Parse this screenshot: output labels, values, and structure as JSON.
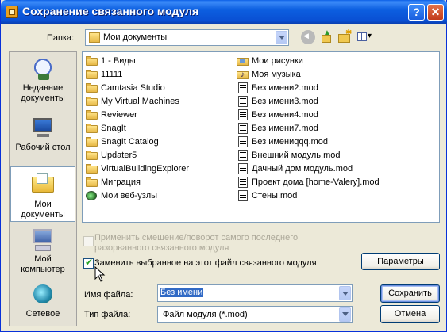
{
  "window": {
    "title": "Сохранение связанного модуля",
    "help_label": "?",
    "close_label": "✕"
  },
  "folder": {
    "label": "Папка:",
    "current": "Мои документы"
  },
  "places": [
    {
      "label": "Недавние документы",
      "icon": "recent-documents-icon"
    },
    {
      "label": "Рабочий стол",
      "icon": "desktop-icon"
    },
    {
      "label": "Мои документы",
      "icon": "my-documents-icon",
      "selected": true
    },
    {
      "label": "Мой компьютер",
      "icon": "my-computer-icon"
    },
    {
      "label": "Сетевое",
      "icon": "network-icon"
    }
  ],
  "files": {
    "col1": [
      {
        "name": "1 - Виды",
        "icon": "folder-icon"
      },
      {
        "name": "11111",
        "icon": "folder-icon"
      },
      {
        "name": "Camtasia Studio",
        "icon": "folder-icon"
      },
      {
        "name": "My Virtual Machines",
        "icon": "folder-icon"
      },
      {
        "name": "Reviewer",
        "icon": "folder-icon"
      },
      {
        "name": "SnagIt",
        "icon": "folder-icon"
      },
      {
        "name": "SnagIt Catalog",
        "icon": "folder-icon"
      },
      {
        "name": "Updater5",
        "icon": "folder-icon"
      },
      {
        "name": "VirtualBuildingExplorer",
        "icon": "folder-icon"
      },
      {
        "name": "Миграция",
        "icon": "folder-icon"
      },
      {
        "name": "Мои веб-узлы",
        "icon": "web-folder-icon"
      }
    ],
    "col2": [
      {
        "name": "Мои рисунки",
        "icon": "pictures-folder-icon"
      },
      {
        "name": "Моя музыка",
        "icon": "music-folder-icon"
      },
      {
        "name": "Без имени2.mod",
        "icon": "mod-file-icon"
      },
      {
        "name": "Без имени3.mod",
        "icon": "mod-file-icon"
      },
      {
        "name": "Без имени4.mod",
        "icon": "mod-file-icon"
      },
      {
        "name": "Без имени7.mod",
        "icon": "mod-file-icon"
      },
      {
        "name": "Без имениqqq.mod",
        "icon": "mod-file-icon"
      },
      {
        "name": "Внешний модуль.mod",
        "icon": "mod-file-icon"
      },
      {
        "name": "Дачный дом модуль.mod",
        "icon": "mod-file-icon"
      },
      {
        "name": "Проект дома [home-Valery].mod",
        "icon": "mod-file-icon"
      },
      {
        "name": "Стены.mod",
        "icon": "mod-file-icon"
      }
    ]
  },
  "options": {
    "apply_offset": {
      "line1": "Применить смещение/поворот самого последнего",
      "line2": "разорванного связанного модуля",
      "checked": false,
      "enabled": false
    },
    "replace_selected": {
      "label": "Заменить выбранное на этот файл связанного модуля",
      "checked": true
    }
  },
  "buttons": {
    "params": "Параметры",
    "save": "Сохранить",
    "cancel": "Отмена"
  },
  "filename": {
    "label": "Имя файла:",
    "value": "Без имени"
  },
  "filetype": {
    "label": "Тип файла:",
    "value": "Файл модуля (*.mod)"
  }
}
